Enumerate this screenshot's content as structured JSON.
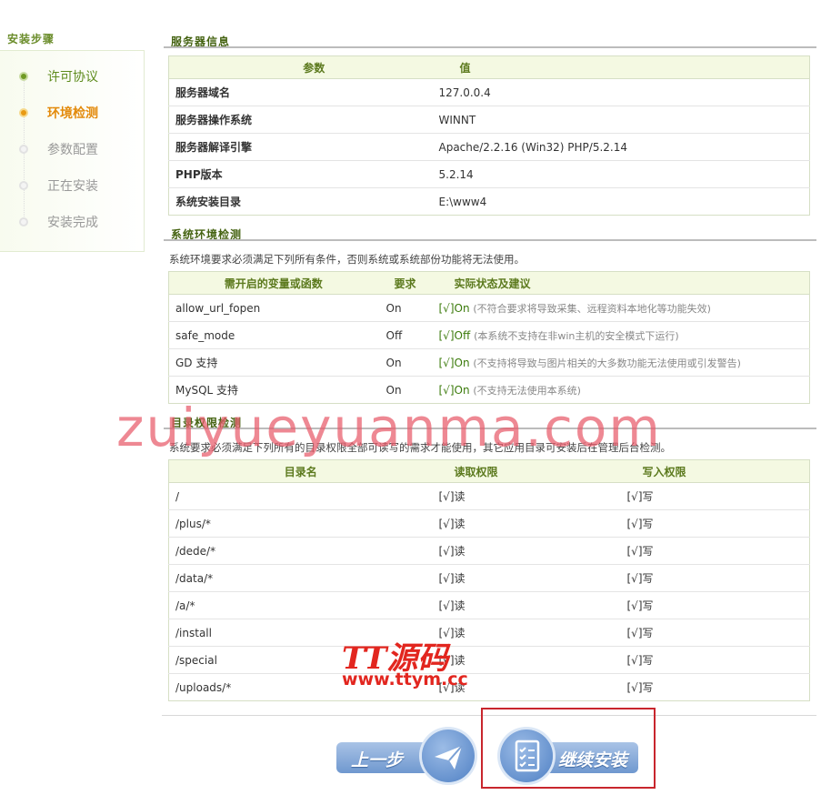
{
  "sidebar": {
    "title": "安装步骤",
    "steps": [
      {
        "label": "许可协议",
        "state": "done"
      },
      {
        "label": "环境检测",
        "state": "current"
      },
      {
        "label": "参数配置",
        "state": "todo"
      },
      {
        "label": "正在安装",
        "state": "todo"
      },
      {
        "label": "安装完成",
        "state": "todo"
      }
    ]
  },
  "server_info": {
    "title": "服务器信息",
    "headers": [
      "参数",
      "值"
    ],
    "rows": [
      {
        "param": "服务器域名",
        "value": "127.0.0.4"
      },
      {
        "param": "服务器操作系统",
        "value": "WINNT"
      },
      {
        "param": "服务器解译引擎",
        "value": "Apache/2.2.16 (Win32) PHP/5.2.14"
      },
      {
        "param": "PHP版本",
        "value": "5.2.14"
      },
      {
        "param": "系统安装目录",
        "value": "E:\\www4"
      }
    ]
  },
  "env_check": {
    "title": "系统环境检测",
    "desc": "系统环境要求必须满足下列所有条件，否则系统或系统部份功能将无法使用。",
    "headers": [
      "需开启的变量或函数",
      "要求",
      "实际状态及建议"
    ],
    "rows": [
      {
        "name": "allow_url_fopen",
        "req": "On",
        "status": "[√]On",
        "note": "(不符合要求将导致采集、远程资料本地化等功能失效)"
      },
      {
        "name": "safe_mode",
        "req": "Off",
        "status": "[√]Off",
        "note": "(本系统不支持在非win主机的安全模式下运行)"
      },
      {
        "name": "GD 支持",
        "req": "On",
        "status": "[√]On",
        "note": "(不支持将导致与图片相关的大多数功能无法使用或引发警告)"
      },
      {
        "name": "MySQL 支持",
        "req": "On",
        "status": "[√]On",
        "note": "(不支持无法使用本系统)"
      }
    ]
  },
  "dir_check": {
    "title": "目录权限检测",
    "desc": "系统要求必须满足下列所有的目录权限全部可读写的需求才能使用，其它应用目录可安装后在管理后台检测。",
    "headers": [
      "目录名",
      "读取权限",
      "写入权限"
    ],
    "rows": [
      {
        "dir": "/",
        "read": "[√]读",
        "write": "[√]写"
      },
      {
        "dir": "/plus/*",
        "read": "[√]读",
        "write": "[√]写"
      },
      {
        "dir": "/dede/*",
        "read": "[√]读",
        "write": "[√]写"
      },
      {
        "dir": "/data/*",
        "read": "[√]读",
        "write": "[√]写"
      },
      {
        "dir": "/a/*",
        "read": "[√]读",
        "write": "[√]写"
      },
      {
        "dir": "/install",
        "read": "[√]读",
        "write": "[√]写"
      },
      {
        "dir": "/special",
        "read": "[√]读",
        "write": "[√]写"
      },
      {
        "dir": "/uploads/*",
        "read": "[√]读",
        "write": "[√]写"
      }
    ]
  },
  "buttons": {
    "prev": "上一步",
    "next": "继续安装"
  },
  "watermarks": {
    "site": "zuiyueyuanma.com",
    "brand": "TT源码",
    "brand_url": "www.ttym.cc"
  },
  "colors": {
    "accent_green": "#5d8b1c",
    "current_orange": "#e38a0b",
    "button_blue": "#6f98cf",
    "highlight_red": "#c8262d"
  }
}
